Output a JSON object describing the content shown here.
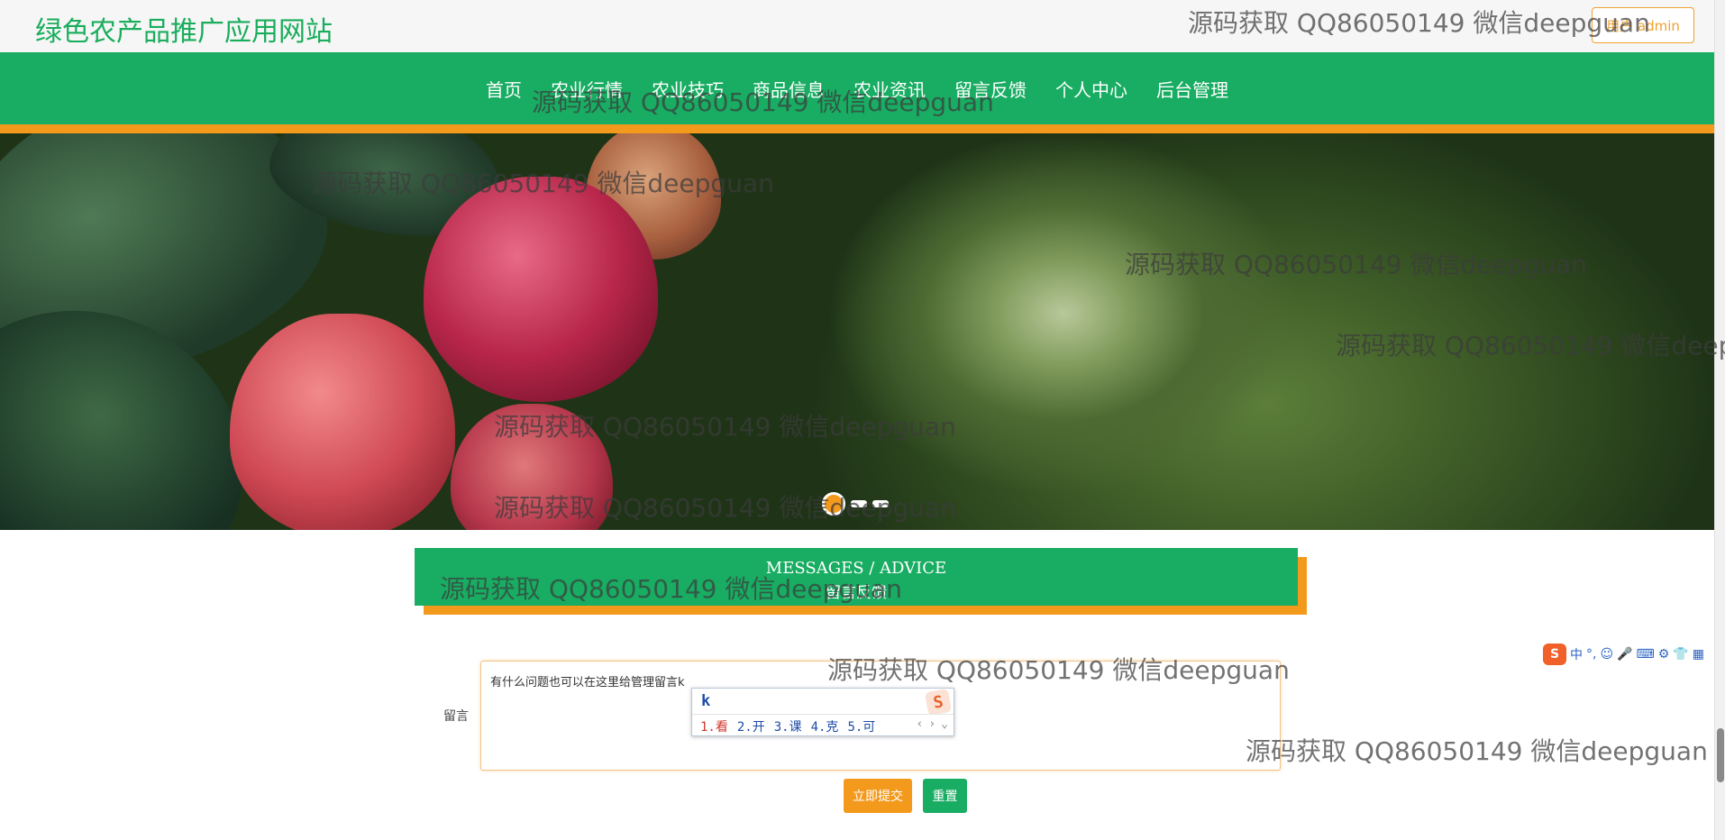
{
  "site": {
    "title": "绿色农产品推广应用网站",
    "user_button": "用户 admin"
  },
  "nav": {
    "items": [
      "首页",
      "农业行情",
      "农业技巧",
      "商品信息",
      "农业资讯",
      "留言反馈",
      "个人中心",
      "后台管理"
    ]
  },
  "banner": {
    "slides": 3,
    "active_slide": 1
  },
  "section": {
    "title_en": "MESSAGES / ADVICE",
    "title_cn": "留言反馈"
  },
  "form": {
    "label": "留言",
    "message_value": "有什么问题也可以在这里给管理留言k",
    "submit_label": "立即提交",
    "reset_label": "重置"
  },
  "ime": {
    "input": "k",
    "candidates": [
      "1.看",
      "2.开",
      "3.课",
      "4.克",
      "5.可"
    ],
    "logo": "S"
  },
  "watermark": "源码获取 QQ86050149 微信deepguan",
  "colors": {
    "brand_green": "#18ad62",
    "accent_orange": "#f39a1d"
  }
}
